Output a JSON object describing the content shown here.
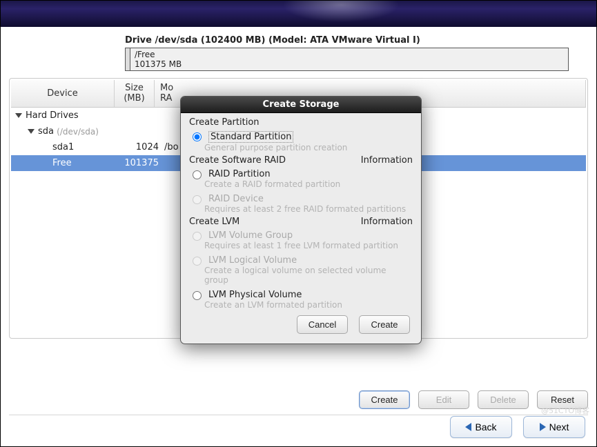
{
  "banner": {},
  "drive": {
    "title": "Drive /dev/sda (102400 MB) (Model: ATA VMware Virtual I)",
    "used_label": "",
    "free_line1": "/Free",
    "free_line2": "101375 MB"
  },
  "tree": {
    "headers": {
      "device": "Device",
      "size_line1": "Size",
      "size_line2": "(MB)",
      "mount_head1": "Mo",
      "mount_head2": "RA"
    },
    "rows": {
      "hard_drives": "Hard Drives",
      "sda_label": "sda",
      "sda_path": "(/dev/sda)",
      "sda1_label": "sda1",
      "sda1_size": "1024",
      "sda1_mnt": "/bo",
      "free_label": "Free",
      "free_size": "101375"
    }
  },
  "dialog": {
    "title": "Create Storage",
    "create_partition": "Create Partition",
    "std_partition": "Standard Partition",
    "std_desc": "General purpose partition creation",
    "create_raid": "Create Software RAID",
    "information": "Information",
    "raid_partition": "RAID Partition",
    "raid_partition_desc": "Create a RAID formated partition",
    "raid_device": "RAID Device",
    "raid_device_desc": "Requires at least 2 free RAID formated partitions",
    "create_lvm": "Create LVM",
    "lvm_vg": "LVM Volume Group",
    "lvm_vg_desc": "Requires at least 1 free LVM formated partition",
    "lvm_lv": "LVM Logical Volume",
    "lvm_lv_desc": "Create a logical volume on selected volume group",
    "lvm_pv": "LVM Physical Volume",
    "lvm_pv_desc": "Create an LVM formated partition",
    "cancel": "Cancel",
    "create": "Create"
  },
  "main_buttons": {
    "create": "Create",
    "edit": "Edit",
    "delete": "Delete",
    "reset": "Reset"
  },
  "nav": {
    "back": "Back",
    "next": "Next"
  },
  "watermark": "@51CTO博客"
}
